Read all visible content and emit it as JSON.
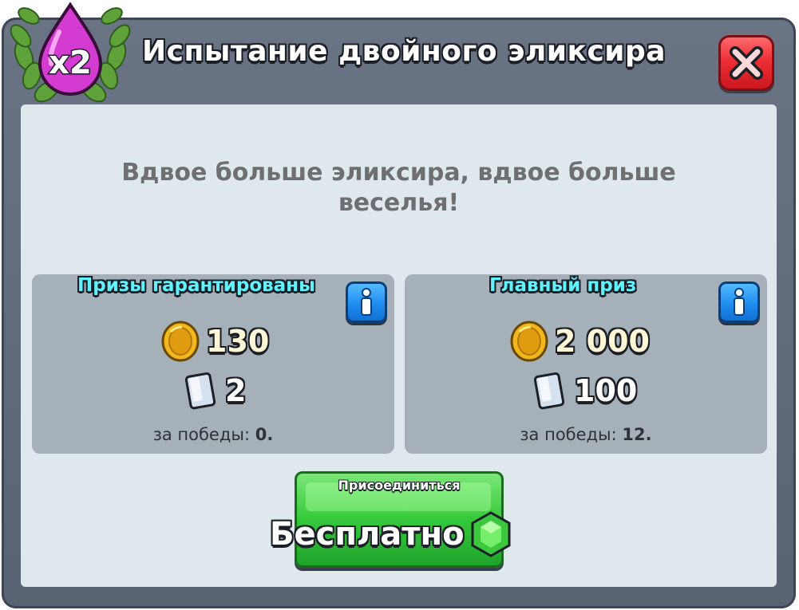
{
  "header": {
    "badge_text": "x2",
    "title": "Испытание двойного эликсира"
  },
  "subtitle": {
    "line1": "Вдвое больше эликсира, вдвое больше",
    "line2": "веселья!"
  },
  "guaranteed": {
    "title": "Призы гарантированы",
    "gold": "130",
    "cards": "2",
    "wins_label": "за победы:",
    "wins_value": "0."
  },
  "grand": {
    "title": "Главный приз",
    "gold": "2 000",
    "cards": "100",
    "wins_label": "за победы:",
    "wins_value": "12."
  },
  "join": {
    "label": "Присоединиться",
    "price": "Бесплатно"
  },
  "icons": {
    "badge": "elixir-laurel-badge-icon",
    "close": "close-x-icon",
    "info": "info-icon",
    "gold": "gold-coin-icon",
    "cards": "card-icon",
    "gem": "gem-icon"
  },
  "colors": {
    "frame": "#5f6979",
    "panel": "#dfe8ed",
    "reward_box": "#a6b0b9",
    "reward_title": "#5ff3ff",
    "close_button": "#ee2f36",
    "info_button": "#1f8cf0",
    "join_button": "#35c93b",
    "elixir": "#d43bd0"
  }
}
